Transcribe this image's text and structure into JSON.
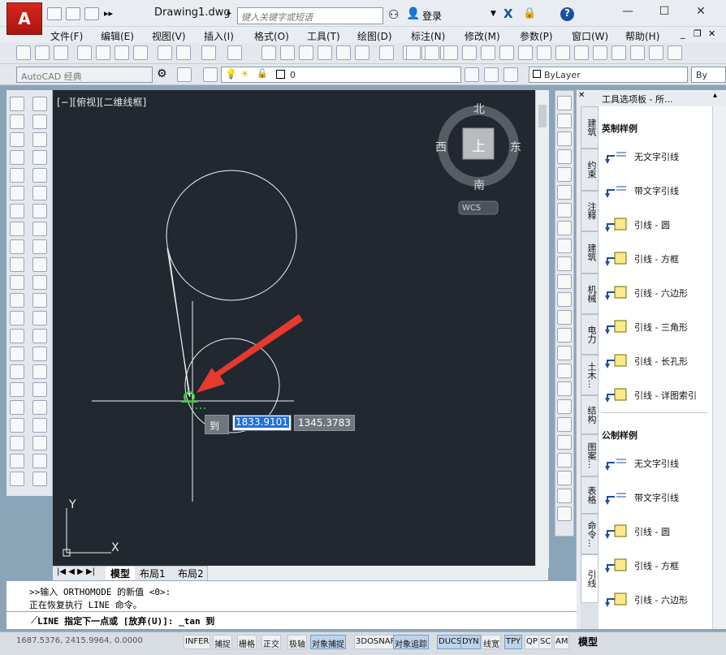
{
  "app": {
    "logo_text": "A",
    "doc_title": "Drawing1.dwg",
    "search_placeholder": "键入关键字或短语",
    "login_label": "登录"
  },
  "menu": [
    "文件(F)",
    "编辑(E)",
    "视图(V)",
    "插入(I)",
    "格式(O)",
    "工具(T)",
    "绘图(D)",
    "标注(N)",
    "修改(M)",
    "参数(P)",
    "窗口(W)",
    "帮助(H)"
  ],
  "toolbar": {
    "workspace": "AutoCAD 经典",
    "layer_value": "0",
    "color_value": "ByLayer",
    "linetype_value": "By"
  },
  "viewport": {
    "label": "[−][俯视][二维线框]"
  },
  "viewcube": {
    "north": "北",
    "south": "南",
    "east": "东",
    "west": "西",
    "top": "上",
    "wcs": "WCS"
  },
  "ucs": {
    "y": "Y",
    "x": "X"
  },
  "dynamic_input": {
    "prompt": "到",
    "x_value": "1833.9101",
    "y_value": "1345.3783"
  },
  "layout_tabs": [
    "模型",
    "布局1",
    "布局2"
  ],
  "palette": {
    "title": "工具选项板 - 所...",
    "tabs": [
      "建筑",
      "约束",
      "注释",
      "建筑",
      "机械",
      "电力",
      "土木...",
      "结构",
      "图案...",
      "表格",
      "命令...",
      "引线"
    ],
    "active_tab": "引线",
    "sections": [
      {
        "title": "英制样例",
        "items": [
          "无文字引线",
          "带文字引线",
          "引线 - 圆",
          "引线 - 方框",
          "引线 - 六边形",
          "引线 - 三角形",
          "引线 - 长孔形",
          "引线 - 详图索引"
        ]
      },
      {
        "title": "公制样例",
        "items": [
          "无文字引线",
          "带文字引线",
          "引线 - 圆",
          "引线 - 方框",
          "引线 - 六边形"
        ]
      }
    ]
  },
  "command": {
    "history": [
      ">>输入 ORTHOMODE 的新值 <0>:",
      "正在恢复执行 LINE 命令。"
    ],
    "line": "LINE 指定下一点或 [放弃(U)]: _tan 到"
  },
  "status": {
    "coords": "1687.5376, 2415.9964, 0.0000",
    "buttons": [
      "INFER",
      "捕捉",
      "栅格",
      "正交",
      "极轴",
      "对象捕捉",
      "3DOSNAP",
      "对象追踪",
      "DUCS",
      "DYN",
      "线宽",
      "TPY",
      "QP",
      "SC",
      "AM"
    ],
    "on_buttons": [
      "对象捕捉",
      "对象追踪",
      "DUCS",
      "DYN",
      "TPY"
    ],
    "model_label": "模型"
  },
  "colors": {
    "canvas": "#212830",
    "accent_red": "#e63a2e",
    "snap_green": "#2fd62f"
  }
}
